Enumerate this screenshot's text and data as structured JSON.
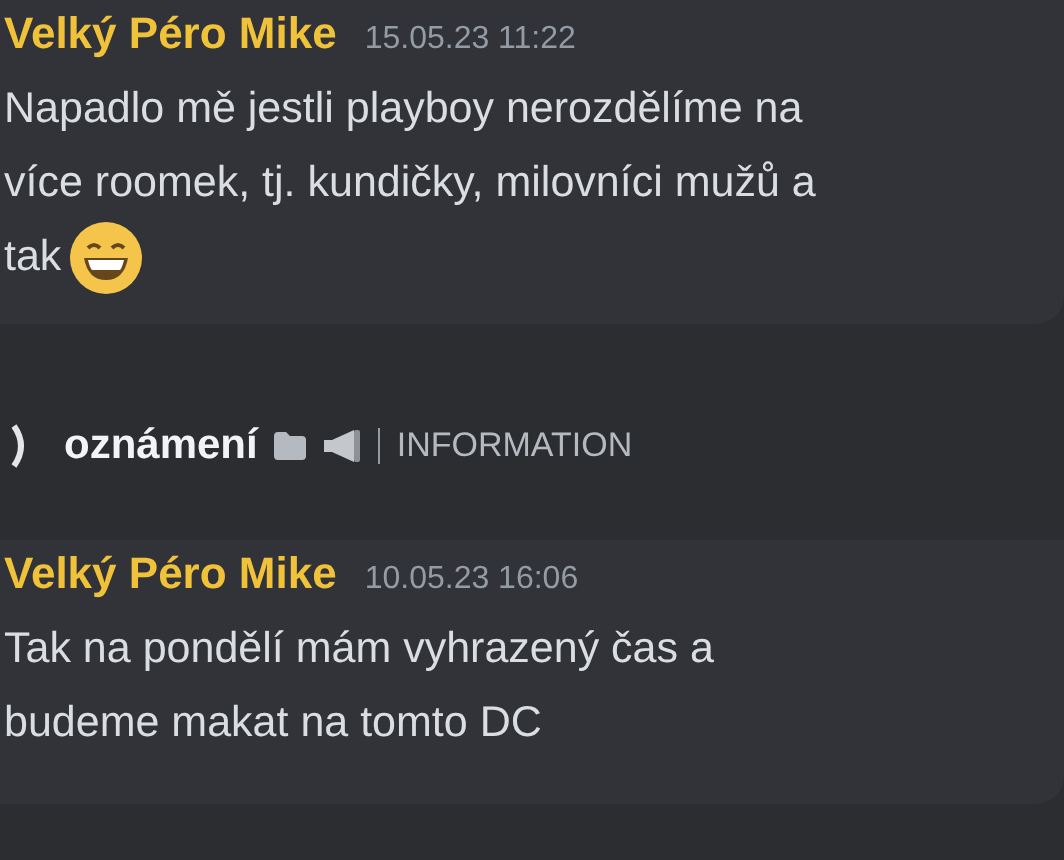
{
  "messages": [
    {
      "author": "Velký Péro Mike",
      "timestamp": "15.05.23 11:22",
      "lines": [
        "Napadlo mě jestli playboy nerozdělíme na",
        "více roomek, tj. kundičky, milovníci mužů a",
        "tak"
      ],
      "emoji_after": true
    },
    {
      "author": "Velký Péro Mike",
      "timestamp": "10.05.23 16:06",
      "lines": [
        "Tak na pondělí mám vyhrazený čas a",
        "budeme makat na tomto DC"
      ]
    }
  ],
  "channel": {
    "name": "oznámení",
    "category": "INFORMATION"
  }
}
